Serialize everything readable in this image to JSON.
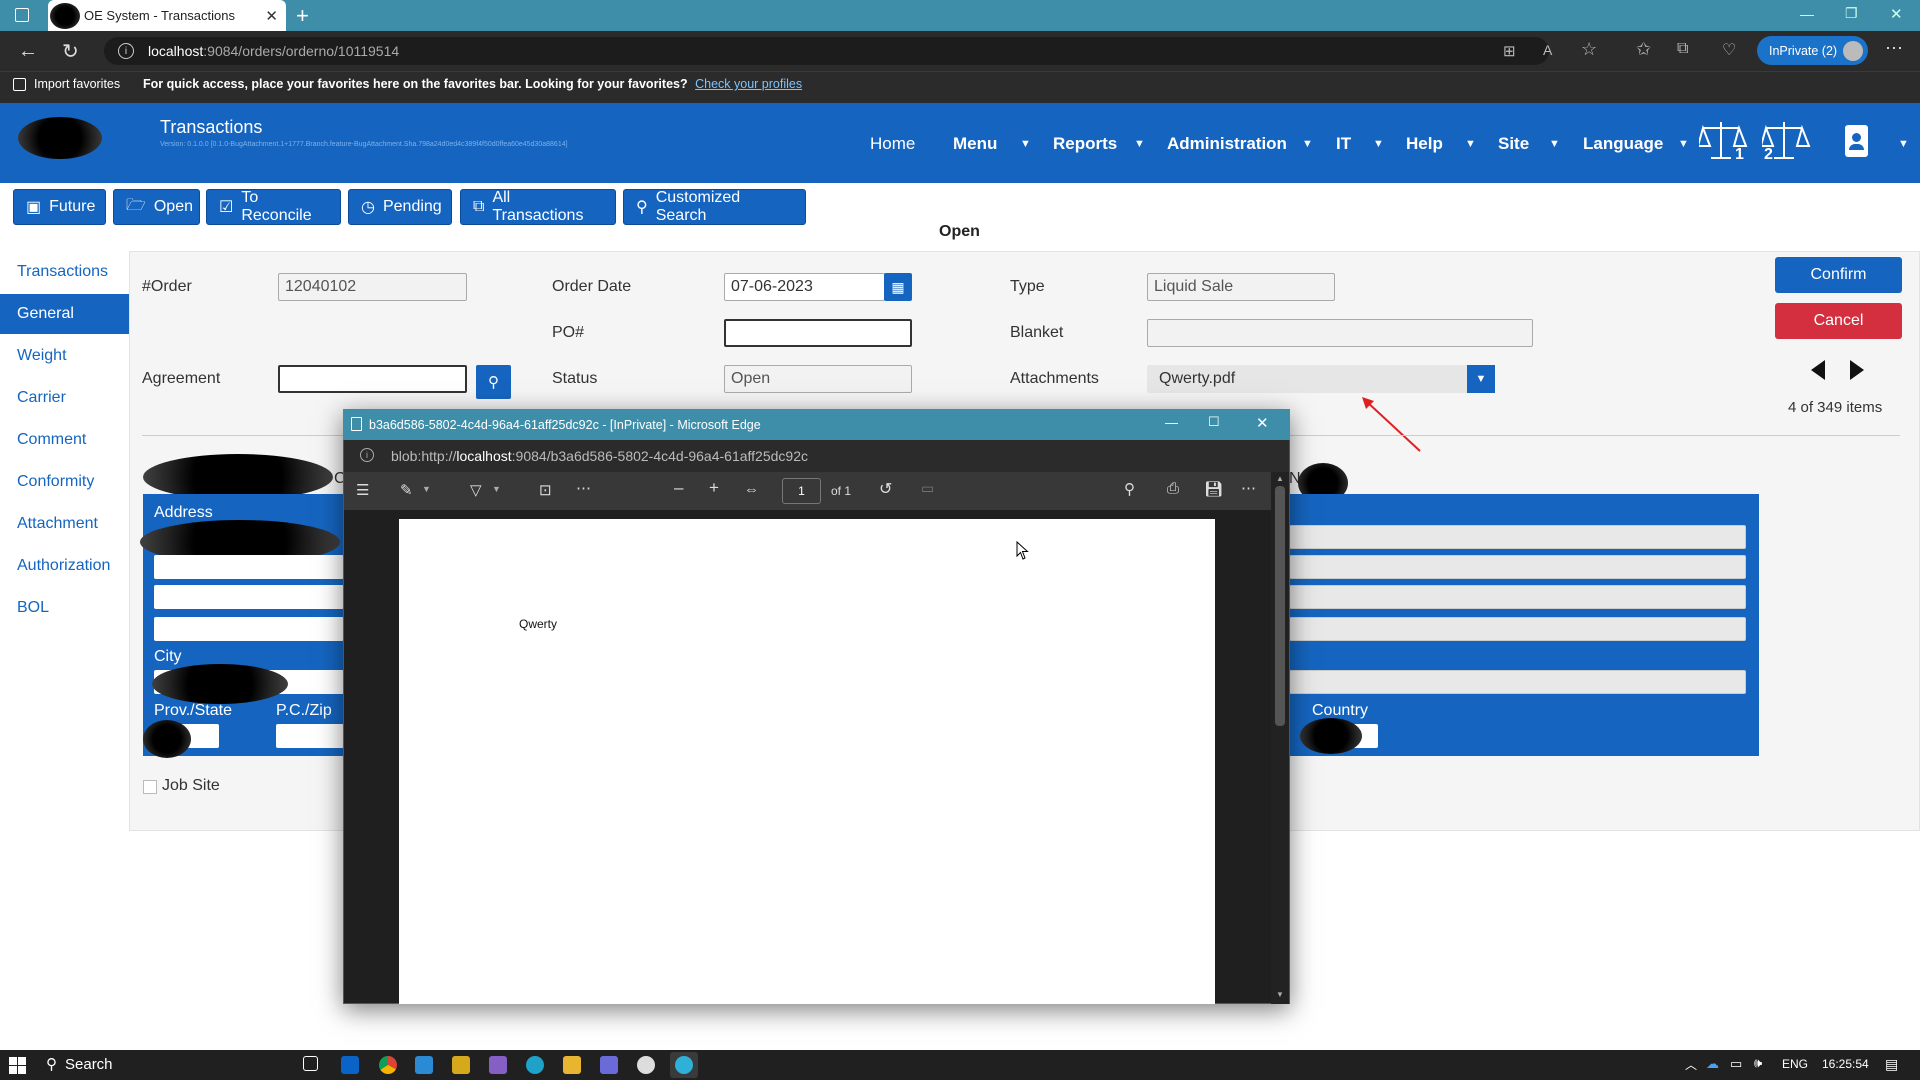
{
  "browser": {
    "tab_title": "OE System - Transactions",
    "url_host": "localhost",
    "url_rest": ":9084/orders/orderno/10119514",
    "inprivate_label": "InPrivate (2)",
    "favbar_import": "Import favorites",
    "favbar_message": "For quick access, place your favorites here on the favorites bar. Looking for your favorites?",
    "favbar_link": "Check your profiles"
  },
  "app": {
    "title": "Transactions",
    "version": "Version: 0.1.0.0 [0.1.0-BugAttachment.1+1777.Branch.feature-BugAttachment.Sha.798a24d0ed4c389f4f50d0ffea60e45d30a88614]",
    "nav": [
      "Home",
      "Menu",
      "Reports",
      "Administration",
      "IT",
      "Help",
      "Site",
      "Language"
    ],
    "scale1": "1",
    "scale2": "2",
    "accent": "#1565c0"
  },
  "quick_buttons": [
    "Future",
    "Open",
    "To Reconcile",
    "Pending",
    "All Transactions",
    "Customized Search"
  ],
  "status_heading": "Open",
  "sidebar": [
    "Transactions",
    "General",
    "Weight",
    "Carrier",
    "Comment",
    "Conformity",
    "Attachment",
    "Authorization",
    "BOL"
  ],
  "form": {
    "order_label": "#Order",
    "order_value": "12040102",
    "order_date_label": "Order Date",
    "order_date_value": "07-06-2023",
    "type_label": "Type",
    "type_value": "Liquid Sale",
    "po_label": "PO#",
    "po_value": "",
    "blanket_label": "Blanket",
    "blanket_value": "",
    "agreement_label": "Agreement",
    "agreement_value": "",
    "status_label": "Status",
    "status_value": "Open",
    "attachments_label": "Attachments",
    "attachments_value": "Qwerty.pdf",
    "address_label": "Address",
    "city_label": "City",
    "prov_label": "Prov./State",
    "zip_label": "P.C./Zip",
    "country_label": "Country",
    "right_partial": "N",
    "left_partial": "C",
    "jobsite_label": "Job Site"
  },
  "actions": {
    "confirm": "Confirm",
    "cancel": "Cancel",
    "confirm_color": "#1565c0",
    "cancel_color": "#d32f3f",
    "pager": "4 of 349 items"
  },
  "popup": {
    "title": "b3a6d586-5802-4c4d-96a4-61aff25dc92c - [InPrivate] - Microsoft Edge",
    "url_prefix": "blob:http://",
    "url_host": "localhost",
    "url_rest": ":9084/b3a6d586-5802-4c4d-96a4-61aff25dc92c",
    "page_value": "1",
    "page_of": "of 1",
    "pdf_text": "Qwerty"
  },
  "taskbar": {
    "search": "Search",
    "lang": "ENG",
    "time": "16:25:54"
  }
}
